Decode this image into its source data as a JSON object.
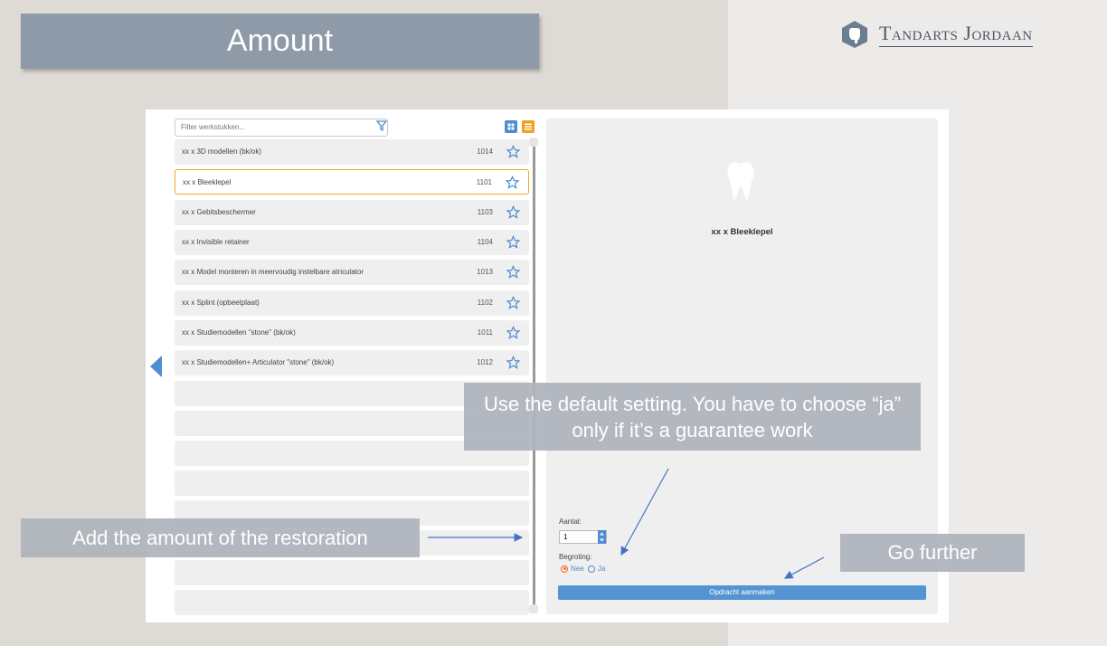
{
  "slide": {
    "title": "Amount",
    "logo_text": "Tandarts Jordaan"
  },
  "app": {
    "filter_placeholder": "Filter werkstukken...",
    "items": [
      {
        "label": "xx x 3D modellen (bk/ok)",
        "code": "1014"
      },
      {
        "label": "xx x Bleeklepel",
        "code": "1101"
      },
      {
        "label": "xx x Gebitsbeschermer",
        "code": "1103"
      },
      {
        "label": "xx x Invisible retainer",
        "code": "1104"
      },
      {
        "label": "xx x Model monteren in meervoudig instelbare atriculator",
        "code": "1013"
      },
      {
        "label": "xx x Splint (opbeetplaat)",
        "code": "1102"
      },
      {
        "label": "xx x Studiemodellen \"stone\" (bk/ok)",
        "code": "1011"
      },
      {
        "label": "xx x Studiemodellen+ Articulator \"stone\" (bk/ok)",
        "code": "1012"
      }
    ],
    "selected_index": 1,
    "detail": {
      "title": "xx x Bleeklepel",
      "aantal_label": "Aantal:",
      "aantal_value": "1",
      "begroting_label": "Begroting:",
      "option_nee": "Nee",
      "option_ja": "Ja",
      "selected_option": "Nee",
      "submit_label": "Opdracht aanmaken"
    },
    "colors": {
      "accent_blue": "#5594d2",
      "selected_orange": "#efa826"
    }
  },
  "callouts": {
    "default_setting": "Use the default setting. You have to choose “ja” only if it’s a guarantee work",
    "amount": "Add the amount of the restoration",
    "go_further": "Go further"
  }
}
